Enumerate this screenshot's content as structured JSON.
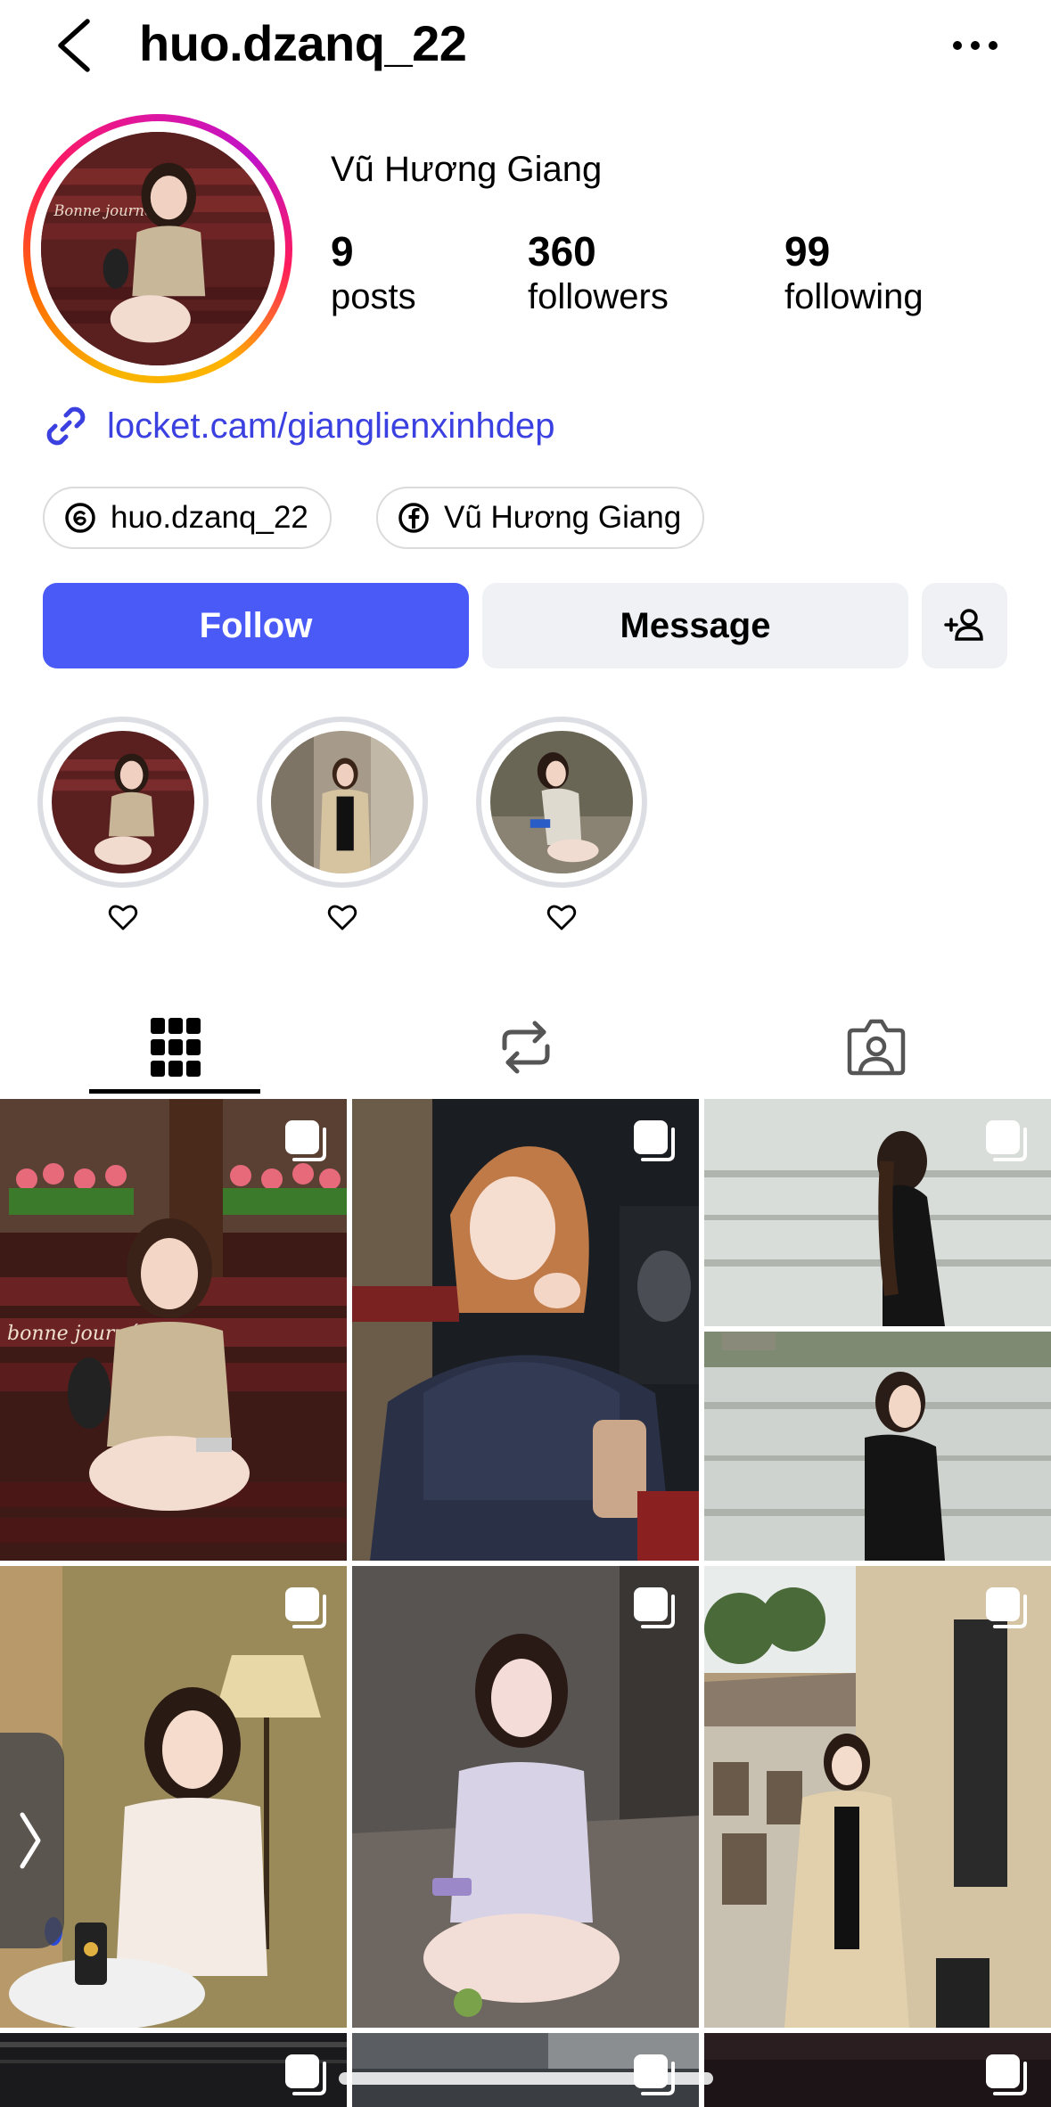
{
  "header": {
    "username": "huo.dzanq_22"
  },
  "profile": {
    "full_name": "Vũ Hương Giang",
    "stats": [
      {
        "value": "9",
        "label": "posts"
      },
      {
        "value": "360",
        "label": "followers"
      },
      {
        "value": "99",
        "label": "following"
      }
    ],
    "link": "locket.cam/gianglienxinhdep",
    "pills": [
      {
        "icon": "threads-icon",
        "label": "huo.dzanq_22"
      },
      {
        "icon": "facebook-icon",
        "label": "Vũ Hương Giang"
      }
    ]
  },
  "actions": {
    "follow_label": "Follow",
    "message_label": "Message"
  },
  "tabs": [
    {
      "icon": "grid-icon",
      "active": true
    },
    {
      "icon": "reposts-icon",
      "active": false
    },
    {
      "icon": "tagged-icon",
      "active": false
    }
  ],
  "colors": {
    "follow_button": "#4a5af7",
    "link": "#3b40e0",
    "secondary_button": "#eff1f5"
  }
}
